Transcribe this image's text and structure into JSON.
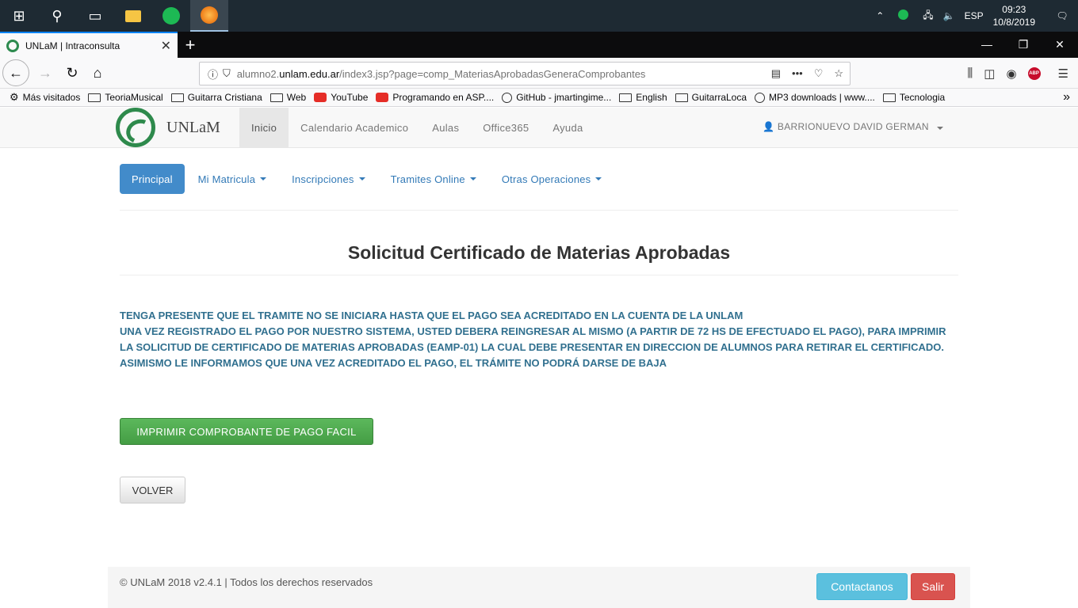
{
  "taskbar": {
    "lang": "ESP",
    "time": "09:23",
    "date": "10/8/2019",
    "icons": [
      "windows-start-icon",
      "search-icon",
      "task-view-icon",
      "file-explorer-icon",
      "spotify-icon",
      "firefox-icon"
    ]
  },
  "browser": {
    "tab_title": "UNLaM | Intraconsulta",
    "url_prefix": "alumno2.",
    "url_host": "unlam.edu.ar",
    "url_path": "/index3.jsp?page=comp_MateriasAprobadasGeneraComprobantes",
    "abp": "ABP"
  },
  "bookmarks": [
    {
      "label": "Más visitados",
      "icon": "gear"
    },
    {
      "label": "TeoriaMusical",
      "icon": "folder"
    },
    {
      "label": "Guitarra Cristiana",
      "icon": "folder"
    },
    {
      "label": "Web",
      "icon": "folder"
    },
    {
      "label": "YouTube",
      "icon": "yt"
    },
    {
      "label": "Programando en ASP....",
      "icon": "yt"
    },
    {
      "label": "GitHub - jmartingime...",
      "icon": "globe"
    },
    {
      "label": "English",
      "icon": "folder"
    },
    {
      "label": "GuitarraLoca",
      "icon": "folder"
    },
    {
      "label": "MP3 downloads | www....",
      "icon": "globe"
    },
    {
      "label": "Tecnologia",
      "icon": "folder"
    }
  ],
  "site": {
    "brand": "UNLaM",
    "nav": [
      "Inicio",
      "Calendario Academico",
      "Aulas",
      "Office365",
      "Ayuda"
    ],
    "user": "BARRIONUEVO DAVID GERMAN"
  },
  "pills": [
    "Principal",
    "Mi Matricula",
    "Inscripciones",
    "Tramites Online",
    "Otras Operaciones"
  ],
  "page": {
    "title": "Solicitud Certificado de Materias Aprobadas",
    "notice_1": "TENGA PRESENTE QUE EL TRAMITE NO SE INICIARA HASTA QUE EL PAGO SEA ACREDITADO EN LA CUENTA DE LA UNLAM",
    "notice_2": "UNA VEZ REGISTRADO EL PAGO POR NUESTRO SISTEMA, USTED DEBERA REINGRESAR AL MISMO (A PARTIR DE 72 HS DE EFECTUADO EL PAGO), PARA IMPRIMIR LA SOLICITUD DE CERTIFICADO DE MATERIAS APROBADAS (EAMP-01) LA CUAL DEBE PRESENTAR EN DIRECCION DE ALUMNOS PARA RETIRAR EL CERTIFICADO.",
    "notice_3": "ASIMISMO LE INFORMAMOS QUE UNA VEZ ACREDITADO EL PAGO, EL TRÁMITE NO PODRÁ DARSE DE BAJA",
    "print_button": "IMPRIMIR COMPROBANTE DE PAGO FACIL",
    "back_button": "VOLVER"
  },
  "footer": {
    "text": "© UNLaM 2018 v2.4.1 | Todos los derechos reservados",
    "contact": "Contactanos",
    "exit": "Salir"
  }
}
